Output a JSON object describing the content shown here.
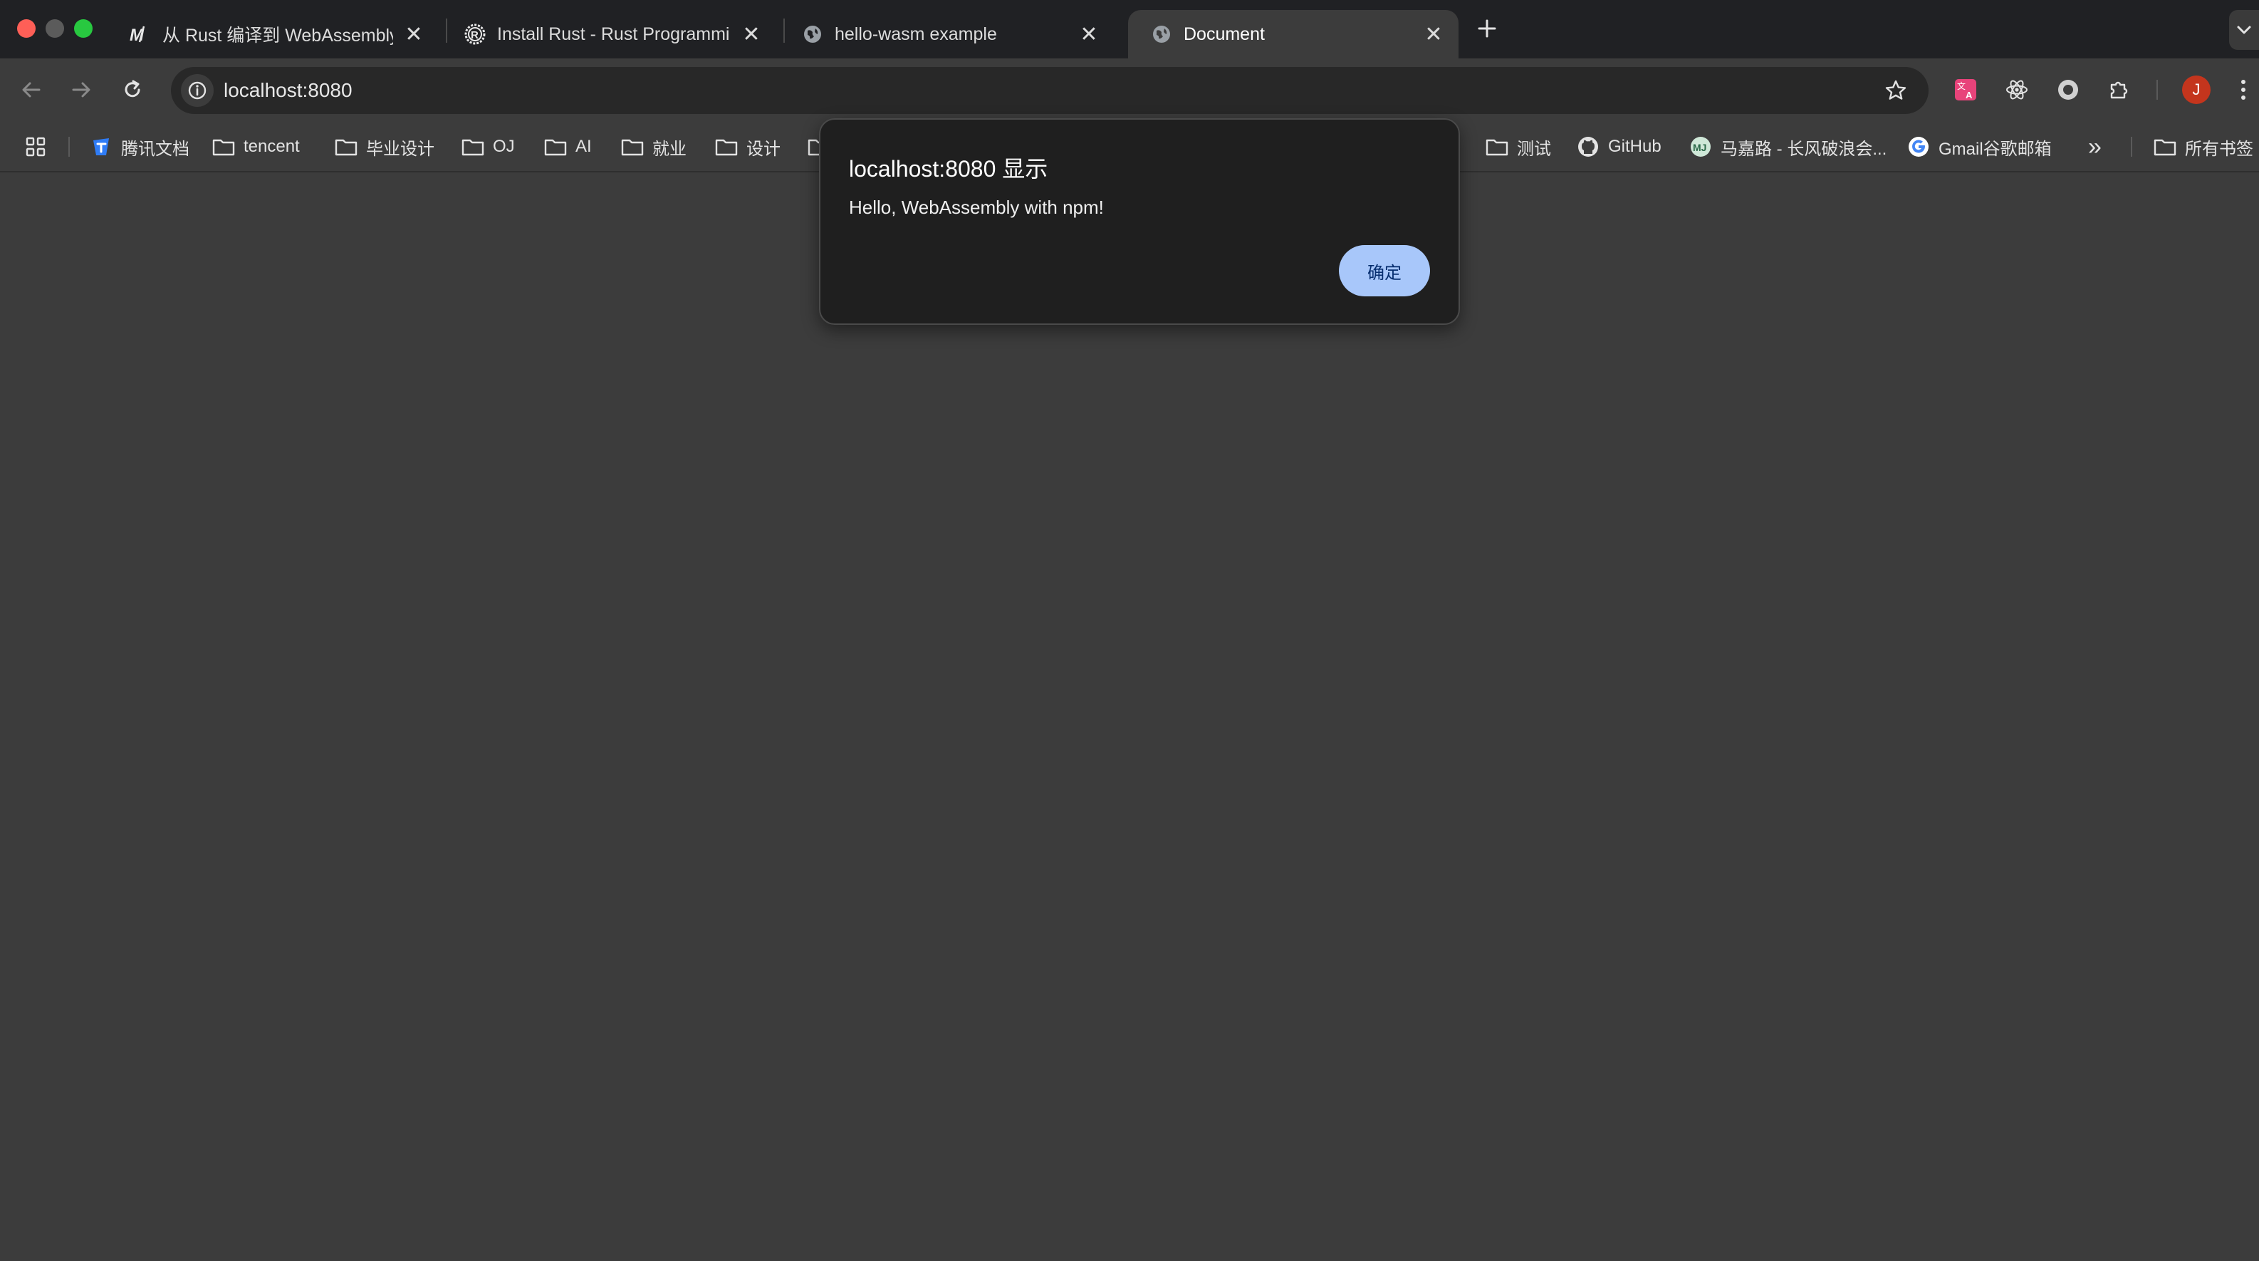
{
  "tabs": [
    {
      "title": "从 Rust 编译到 WebAssembly",
      "favicon": "mdn-icon",
      "active": false
    },
    {
      "title": "Install Rust - Rust Programming Language",
      "favicon": "rust-icon",
      "active": false
    },
    {
      "title": "hello-wasm example",
      "favicon": "globe-icon",
      "active": false
    },
    {
      "title": "Document",
      "favicon": "globe-icon",
      "active": true
    }
  ],
  "tab_close_glyph": "✕",
  "new_tab_glyph": "+",
  "address": {
    "url": "localhost:8080"
  },
  "avatar_letter": "J",
  "bookmarks": [
    {
      "label": "腾讯文档",
      "icon": "tencent-docs-icon"
    },
    {
      "label": "tencent",
      "icon": "folder-icon"
    },
    {
      "label": "毕业设计",
      "icon": "folder-icon"
    },
    {
      "label": "OJ",
      "icon": "folder-icon"
    },
    {
      "label": "AI",
      "icon": "folder-icon"
    },
    {
      "label": "就业",
      "icon": "folder-icon"
    },
    {
      "label": "设计",
      "icon": "folder-icon"
    },
    {
      "label": "测试",
      "icon": "folder-icon"
    },
    {
      "label": "GitHub",
      "icon": "github-icon"
    },
    {
      "label": "马嘉路 - 长风破浪会...",
      "icon": "site-icon"
    },
    {
      "label": "Gmail谷歌邮箱",
      "icon": "google-icon"
    },
    {
      "label": "所有书签",
      "icon": "folder-icon"
    }
  ],
  "overflow_glyph": "»",
  "dialog": {
    "title": "localhost:8080 显示",
    "message": "Hello, WebAssembly with npm!",
    "ok_label": "确定"
  },
  "colors": {
    "page_bg": "#3c3c3c",
    "tabstrip_bg": "#202124",
    "dialog_bg": "#1f1f1f",
    "button_bg": "#a8c7fa",
    "button_text": "#062e6f",
    "avatar_bg": "#c4351d"
  }
}
